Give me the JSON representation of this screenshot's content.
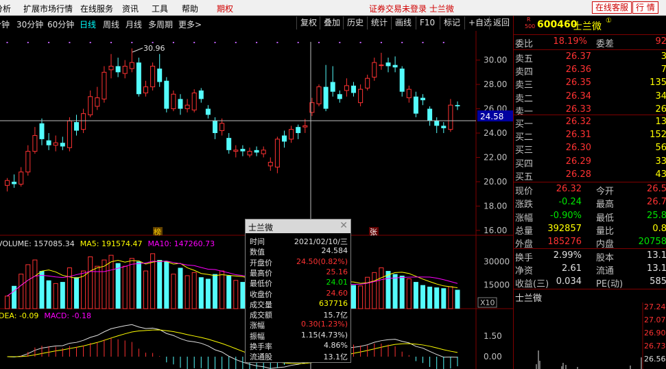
{
  "menubar": {
    "items": [
      "分析",
      "扩展市场行情",
      "在线服务",
      "资讯",
      "工具",
      "帮助"
    ],
    "futures": "期权",
    "status": "证券交易未登录 士兰微",
    "btn_service": "在线客服",
    "btn_quote": "行 情"
  },
  "periods": [
    "分钟",
    "30分钟",
    "60分钟",
    "日线",
    "周线",
    "月线",
    "多周期",
    "更多"
  ],
  "active_period": "日线",
  "tools": [
    "复权",
    "叠加",
    "历史",
    "统计",
    "画线",
    "F10",
    "标记",
    "+自选",
    "返回"
  ],
  "chart_data": {
    "type": "candlestick",
    "price_ticks": [
      "30.00",
      "28.00",
      "26.00",
      "24.00",
      "22.00",
      "20.00",
      "18.00",
      "16.00"
    ],
    "ylim": [
      15.6,
      31.5
    ],
    "high_label": "30.96",
    "current_price_label": "24.58",
    "markers": [
      "榜",
      "张"
    ],
    "vol_legend": {
      "vol": "VOLUME: 157085.34",
      "ma5": "MA5: 191574.47",
      "ma10": "MA10: 147260.73"
    },
    "vol_ticks": [
      "30000",
      "15000"
    ],
    "vol_unit": "X10",
    "macd_legend": {
      "dea": "DEA: -0.09",
      "macd": "MACD: -0.18"
    },
    "macd_ticks": [
      "1.50",
      "0.00"
    ],
    "candles": [
      {
        "o": 19.7,
        "c": 20.1,
        "h": 20.3,
        "l": 19.2
      },
      {
        "o": 20.0,
        "c": 19.8,
        "h": 20.6,
        "l": 19.5
      },
      {
        "o": 19.8,
        "c": 20.8,
        "h": 21.2,
        "l": 19.6
      },
      {
        "o": 20.8,
        "c": 22.5,
        "h": 23.0,
        "l": 20.5
      },
      {
        "o": 22.5,
        "c": 23.8,
        "h": 24.5,
        "l": 22.3
      },
      {
        "o": 24.8,
        "c": 23.5,
        "h": 25.2,
        "l": 23.0
      },
      {
        "o": 23.4,
        "c": 23.0,
        "h": 24.0,
        "l": 22.6
      },
      {
        "o": 23.0,
        "c": 23.2,
        "h": 23.8,
        "l": 22.5
      },
      {
        "o": 23.2,
        "c": 22.9,
        "h": 23.7,
        "l": 22.6
      },
      {
        "o": 22.8,
        "c": 25.0,
        "h": 25.3,
        "l": 22.5
      },
      {
        "o": 24.9,
        "c": 24.2,
        "h": 25.5,
        "l": 23.8
      },
      {
        "o": 24.3,
        "c": 25.6,
        "h": 26.0,
        "l": 24.0
      },
      {
        "o": 25.5,
        "c": 27.0,
        "h": 27.5,
        "l": 25.3
      },
      {
        "o": 26.2,
        "c": 26.9,
        "h": 27.8,
        "l": 25.9
      },
      {
        "o": 26.8,
        "c": 29.0,
        "h": 29.5,
        "l": 26.5
      },
      {
        "o": 29.2,
        "c": 29.5,
        "h": 30.5,
        "l": 28.5
      },
      {
        "o": 29.5,
        "c": 29.0,
        "h": 30.2,
        "l": 28.6
      },
      {
        "o": 28.9,
        "c": 29.5,
        "h": 30.0,
        "l": 28.5
      },
      {
        "o": 29.3,
        "c": 29.8,
        "h": 30.96,
        "l": 29.0
      },
      {
        "o": 29.8,
        "c": 27.2,
        "h": 30.2,
        "l": 27.0
      },
      {
        "o": 27.3,
        "c": 27.8,
        "h": 28.3,
        "l": 27.0
      },
      {
        "o": 27.8,
        "c": 29.5,
        "h": 29.8,
        "l": 27.5
      },
      {
        "o": 29.3,
        "c": 28.2,
        "h": 30.5,
        "l": 27.8
      },
      {
        "o": 28.3,
        "c": 26.0,
        "h": 28.6,
        "l": 25.7
      },
      {
        "o": 26.0,
        "c": 27.2,
        "h": 27.5,
        "l": 25.8
      },
      {
        "o": 26.8,
        "c": 26.0,
        "h": 27.2,
        "l": 25.5
      },
      {
        "o": 26.0,
        "c": 26.3,
        "h": 26.8,
        "l": 25.7
      },
      {
        "o": 25.9,
        "c": 27.3,
        "h": 27.6,
        "l": 25.7
      },
      {
        "o": 27.5,
        "c": 26.8,
        "h": 27.7,
        "l": 26.5
      },
      {
        "o": 26.0,
        "c": 25.5,
        "h": 26.3,
        "l": 25.2
      },
      {
        "o": 25.0,
        "c": 24.0,
        "h": 25.3,
        "l": 23.5
      },
      {
        "o": 24.2,
        "c": 24.8,
        "h": 25.2,
        "l": 23.8
      },
      {
        "o": 23.6,
        "c": 22.6,
        "h": 24.0,
        "l": 22.3
      },
      {
        "o": 22.5,
        "c": 22.6,
        "h": 23.0,
        "l": 22.0
      },
      {
        "o": 22.7,
        "c": 22.5,
        "h": 23.0,
        "l": 22.1
      },
      {
        "o": 22.2,
        "c": 22.5,
        "h": 22.8,
        "l": 22.0
      },
      {
        "o": 22.6,
        "c": 22.4,
        "h": 22.9,
        "l": 22.1
      },
      {
        "o": 22.3,
        "c": 22.6,
        "h": 22.9,
        "l": 22.0
      },
      {
        "o": 21.3,
        "c": 21.6,
        "h": 22.0,
        "l": 20.9
      },
      {
        "o": 21.2,
        "c": 23.5,
        "h": 23.7,
        "l": 20.7
      },
      {
        "o": 23.8,
        "c": 23.3,
        "h": 24.2,
        "l": 22.8
      },
      {
        "o": 23.5,
        "c": 24.3,
        "h": 24.6,
        "l": 23.2
      },
      {
        "o": 24.5,
        "c": 24.0,
        "h": 24.7,
        "l": 23.5
      },
      {
        "o": 24.5,
        "c": 24.6,
        "h": 25.16,
        "l": 24.01
      },
      {
        "o": 25.7,
        "c": 26.5,
        "h": 26.9,
        "l": 25.4
      },
      {
        "o": 26.4,
        "c": 27.8,
        "h": 28.0,
        "l": 26.2
      },
      {
        "o": 27.8,
        "c": 26.0,
        "h": 29.6,
        "l": 25.8
      },
      {
        "o": 28.2,
        "c": 27.4,
        "h": 29.5,
        "l": 27.0
      },
      {
        "o": 27.2,
        "c": 26.8,
        "h": 27.5,
        "l": 26.5
      },
      {
        "o": 27.5,
        "c": 27.9,
        "h": 28.5,
        "l": 27.0
      },
      {
        "o": 27.9,
        "c": 27.3,
        "h": 28.2,
        "l": 27.0
      },
      {
        "o": 26.5,
        "c": 27.6,
        "h": 28.0,
        "l": 26.2
      },
      {
        "o": 27.7,
        "c": 28.5,
        "h": 28.8,
        "l": 27.5
      },
      {
        "o": 28.6,
        "c": 29.8,
        "h": 30.2,
        "l": 28.3
      },
      {
        "o": 29.6,
        "c": 29.6,
        "h": 30.6,
        "l": 29.2
      },
      {
        "o": 29.8,
        "c": 29.5,
        "h": 30.2,
        "l": 29.0
      },
      {
        "o": 29.6,
        "c": 29.4,
        "h": 30.3,
        "l": 29.0
      },
      {
        "o": 29.3,
        "c": 27.4,
        "h": 29.5,
        "l": 27.0
      },
      {
        "o": 26.9,
        "c": 27.6,
        "h": 27.9,
        "l": 26.5
      },
      {
        "o": 27.0,
        "c": 25.6,
        "h": 27.4,
        "l": 25.3
      },
      {
        "o": 26.9,
        "c": 26.7,
        "h": 27.2,
        "l": 26.3
      },
      {
        "o": 26.0,
        "c": 25.0,
        "h": 26.2,
        "l": 24.6
      },
      {
        "o": 25.0,
        "c": 24.6,
        "h": 25.3,
        "l": 24.0
      },
      {
        "o": 24.6,
        "c": 24.4,
        "h": 24.9,
        "l": 24.0
      },
      {
        "o": 24.3,
        "c": 26.3,
        "h": 26.8,
        "l": 24.1
      },
      {
        "o": 26.3,
        "c": 26.2,
        "h": 26.6,
        "l": 25.9
      }
    ],
    "volumes": [
      8000,
      14500,
      22000,
      28000,
      31000,
      24000,
      18000,
      16000,
      17000,
      26000,
      20000,
      24000,
      33000,
      27000,
      31000,
      34000,
      29000,
      27000,
      32000,
      30000,
      24000,
      35000,
      31000,
      30000,
      22000,
      26000,
      21000,
      23000,
      20000,
      19000,
      22000,
      24000,
      21000,
      18000,
      17000,
      16000,
      15000,
      14000,
      13000,
      16000,
      15000,
      14000,
      13000,
      12500,
      14000,
      16000,
      19000,
      18000,
      17000,
      16000,
      15000,
      14500,
      20000,
      23000,
      26000,
      24000,
      22000,
      21000,
      19000,
      17000,
      15000,
      14000,
      13500,
      13000,
      14000,
      12000
    ]
  },
  "popup": {
    "title": "士兰微",
    "rows": [
      {
        "k": "时间",
        "v": "2021/02/10/三",
        "c": "wht"
      },
      {
        "k": "数值",
        "v": "24.584",
        "c": "wht"
      },
      {
        "k": "开盘价",
        "v": "24.50(0.82%)",
        "c": "red"
      },
      {
        "k": "最高价",
        "v": "25.16",
        "c": "red"
      },
      {
        "k": "最低价",
        "v": "24.01",
        "c": "grn"
      },
      {
        "k": "收盘价",
        "v": "24.60",
        "c": "red"
      },
      {
        "k": "成交量",
        "v": "637716",
        "c": "yel"
      },
      {
        "k": "成交额",
        "v": "15.7亿",
        "c": "wht"
      },
      {
        "k": "涨幅",
        "v": "0.30(1.23%)",
        "c": "red"
      },
      {
        "k": "振幅",
        "v": "1.15(4.73%)",
        "c": "wht"
      },
      {
        "k": "换手率",
        "v": "4.86%",
        "c": "wht"
      },
      {
        "k": "流通股",
        "v": "13.1亿",
        "c": "wht"
      }
    ]
  },
  "stock": {
    "code": "600460",
    "name": "士兰微",
    "badge_r": "R",
    "badge_n": "500",
    "info_mark": "①"
  },
  "weibi": {
    "k1": "委比",
    "v1": "18.19%",
    "k2": "委差",
    "v2": "92"
  },
  "asks": [
    {
      "k": "卖五",
      "p": "26.37",
      "q": "3"
    },
    {
      "k": "卖四",
      "p": "26.36",
      "q": "7"
    },
    {
      "k": "卖三",
      "p": "26.35",
      "q": "135"
    },
    {
      "k": "卖二",
      "p": "26.34",
      "q": "34"
    },
    {
      "k": "卖一",
      "p": "26.33",
      "q": "26"
    }
  ],
  "bids": [
    {
      "k": "买一",
      "p": "26.32",
      "q": "13"
    },
    {
      "k": "买二",
      "p": "26.31",
      "q": "152"
    },
    {
      "k": "买三",
      "p": "26.30",
      "q": "56"
    },
    {
      "k": "买四",
      "p": "26.29",
      "q": "33"
    },
    {
      "k": "买五",
      "p": "26.28",
      "q": "43"
    }
  ],
  "quote": [
    {
      "k1": "现价",
      "v1": "26.32",
      "c1": "red",
      "k2": "今开",
      "v2": "26.5",
      "c2": "red"
    },
    {
      "k1": "涨跌",
      "v1": "-0.24",
      "c1": "grn",
      "k2": "最高",
      "v2": "26.7",
      "c2": "red"
    },
    {
      "k1": "涨幅",
      "v1": "-0.90%",
      "c1": "grn",
      "k2": "最低",
      "v2": "25.8",
      "c2": "grn"
    },
    {
      "k1": "总量",
      "v1": "392857",
      "c1": "yel",
      "k2": "量比",
      "v2": "0.8",
      "c2": "yel"
    },
    {
      "k1": "外盘",
      "v1": "185276",
      "c1": "red",
      "k2": "内盘",
      "v2": "20758",
      "c2": "grn"
    }
  ],
  "stats": [
    {
      "k1": "换手",
      "v1": "2.99%",
      "k2": "股本",
      "v2": "13.1"
    },
    {
      "k1": "净资",
      "v1": "2.61",
      "k2": "流通",
      "v2": "13.1"
    },
    {
      "k1": "收益(三)",
      "v1": "0.034",
      "k2": "PE(动)",
      "v2": "585"
    }
  ],
  "mini": {
    "title": "士兰微",
    "ticks": [
      "27.24",
      "27.07",
      "26.90",
      "26.73",
      "26.56"
    ]
  }
}
